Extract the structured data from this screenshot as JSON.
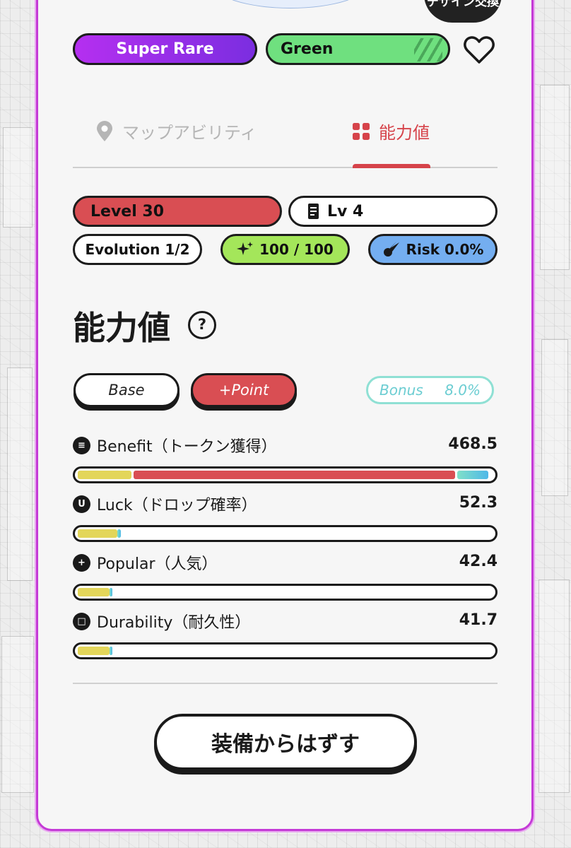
{
  "header": {
    "design_badge": "デザイン交換"
  },
  "tags": {
    "rarity": "Super Rare",
    "color": "Green",
    "rarity_color": "#b52ff0",
    "color_tag_color": "#6fe07f"
  },
  "tabs": [
    {
      "label": "マップアビリティ",
      "icon": "map-pin-icon",
      "active": false
    },
    {
      "label": "能力値",
      "icon": "grid-icon",
      "active": true
    }
  ],
  "badges": {
    "level": "Level 30",
    "mint": "Lv 4",
    "evolution": "Evolution 1/2",
    "stamina": "100 / 100",
    "risk": "Risk 0.0%"
  },
  "section": {
    "title": "能力値",
    "help": "?"
  },
  "modes": {
    "base": "Base",
    "point": "+Point",
    "bonus_label": "Bonus",
    "bonus_value": "8.0%"
  },
  "stats": [
    {
      "icon_glyph": "≡",
      "name": "Benefit（トークン獲得）",
      "value": "468.5",
      "base_frac": 0.13,
      "point_frac": 0.775,
      "bonus_frac": 0.075
    },
    {
      "icon_glyph": "U",
      "name": "Luck（ドロップ確率）",
      "value": "52.3",
      "base_frac": 0.095,
      "point_frac": 0.0,
      "bonus_frac": 0.008
    },
    {
      "icon_glyph": "+",
      "name": "Popular（人気）",
      "value": "42.4",
      "base_frac": 0.077,
      "point_frac": 0.0,
      "bonus_frac": 0.007
    },
    {
      "icon_glyph": "□",
      "name": "Durability（耐久性）",
      "value": "41.7",
      "base_frac": 0.076,
      "point_frac": 0.0,
      "bonus_frac": 0.006
    }
  ],
  "actions": {
    "unequip": "装備からはずす"
  },
  "colors": {
    "accent_red": "#d94e53",
    "border_purple": "#c43ad6",
    "base_yellow": "#e3d65a"
  }
}
